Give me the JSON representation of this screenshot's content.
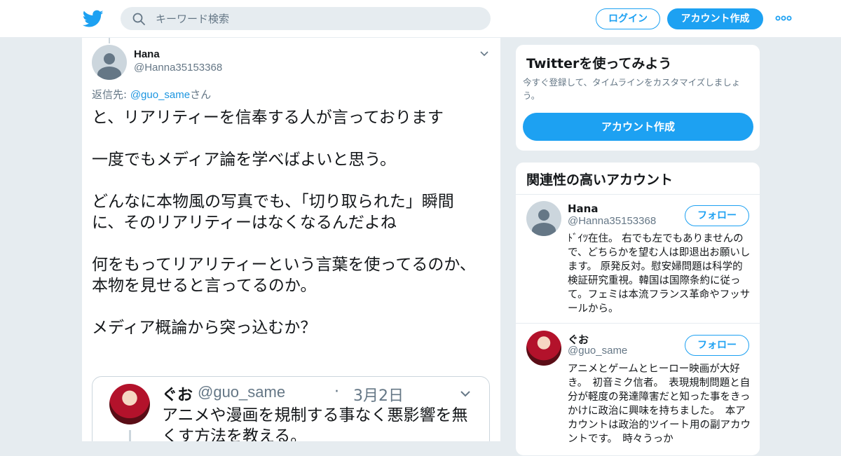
{
  "header": {
    "logo": "twitter-bird-icon",
    "search_placeholder": "キーワード検索",
    "login_label": "ログイン",
    "signup_label": "アカウント作成",
    "more_icon": "more-dots-icon"
  },
  "tweet": {
    "name": "Hana",
    "handle": "@Hanna35153368",
    "reply_prefix": "返信先: ",
    "reply_handle": "@guo_same",
    "reply_suffix": "さん",
    "text": "と、リアリティーを信奉する人が言っております\n\n一度でもメディア論を学べばよいと思う。\n\nどんなに本物風の写真でも、「切り取られた」瞬間に、そのリアリティーはなくなるんだよね\n\n何をもってリアリティーという言葉を使ってるのか、\n本物を見せると言ってるのか。\n\nメディア概論から突っ込むか？",
    "quote": {
      "name": "ぐお",
      "handle": "@guo_same",
      "separator": "·",
      "date": "3月2日",
      "text": "アニメや漫画を規制する事なく悪影響を無くす方法を教える。"
    }
  },
  "sidebar": {
    "signup_card": {
      "title": "Twitterを使ってみよう",
      "description": "今すぐ登録して、タイムラインをカスタマイズしましょう。",
      "cta": "アカウント作成"
    },
    "related": {
      "title": "関連性の高いアカウント",
      "follow_label": "フォロー",
      "accounts": [
        {
          "name": "Hana",
          "handle": "@Hanna35153368",
          "bio": "ﾄﾞｲﾂ在住。 右でも左でもありませんので、どちらかを望む人は即退出お願いします。 原発反対。慰安婦問題は科学的検証研究重視。韓国は国際条約に従って。フェミは本流フランス革命やフッサールから。"
        },
        {
          "name": "ぐお",
          "handle": "@guo_same",
          "bio": "アニメとゲームとヒーロー映画が大好き。　初音ミク信者。　表現規制問題と自分が軽度の発達障害だと知った事をきっかけに政治に興味を持ちました。　本アカウントは政治的ツイート用の副アカウントです。　時々うっか"
        }
      ]
    }
  }
}
